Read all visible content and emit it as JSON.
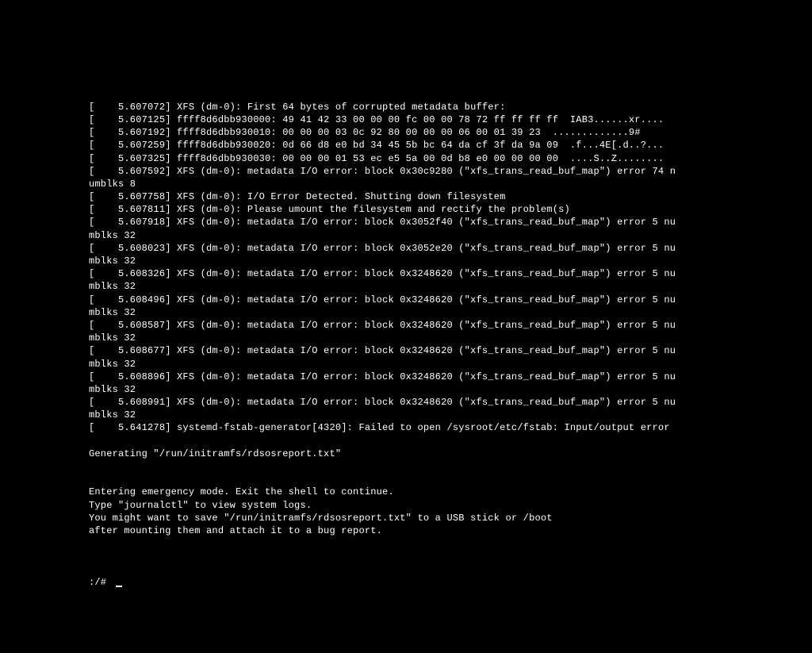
{
  "console": {
    "lines": [
      "[    5.607072] XFS (dm-0): First 64 bytes of corrupted metadata buffer:",
      "[    5.607125] ffff8d6dbb930000: 49 41 42 33 00 00 00 fc 00 00 78 72 ff ff ff ff  IAB3......xr....",
      "[    5.607192] ffff8d6dbb930010: 00 00 00 03 0c 92 80 00 00 00 06 00 01 39 23  .............9#",
      "[    5.607259] ffff8d6dbb930020: 0d 66 d8 e0 bd 34 45 5b bc 64 da cf 3f da 9a 09  .f...4E[.d..?...",
      "[    5.607325] ffff8d6dbb930030: 00 00 00 01 53 ec e5 5a 00 0d b8 e0 00 00 00 00  ....S..Z........",
      "[    5.607592] XFS (dm-0): metadata I/O error: block 0x30c9280 (\"xfs_trans_read_buf_map\") error 74 n",
      "umblks 8",
      "[    5.607758] XFS (dm-0): I/O Error Detected. Shutting down filesystem",
      "[    5.607811] XFS (dm-0): Please umount the filesystem and rectify the problem(s)",
      "[    5.607918] XFS (dm-0): metadata I/O error: block 0x3052f40 (\"xfs_trans_read_buf_map\") error 5 nu",
      "mblks 32",
      "[    5.608023] XFS (dm-0): metadata I/O error: block 0x3052e20 (\"xfs_trans_read_buf_map\") error 5 nu",
      "mblks 32",
      "[    5.608326] XFS (dm-0): metadata I/O error: block 0x3248620 (\"xfs_trans_read_buf_map\") error 5 nu",
      "mblks 32",
      "[    5.608496] XFS (dm-0): metadata I/O error: block 0x3248620 (\"xfs_trans_read_buf_map\") error 5 nu",
      "mblks 32",
      "[    5.608587] XFS (dm-0): metadata I/O error: block 0x3248620 (\"xfs_trans_read_buf_map\") error 5 nu",
      "mblks 32",
      "[    5.608677] XFS (dm-0): metadata I/O error: block 0x3248620 (\"xfs_trans_read_buf_map\") error 5 nu",
      "mblks 32",
      "[    5.608896] XFS (dm-0): metadata I/O error: block 0x3248620 (\"xfs_trans_read_buf_map\") error 5 nu",
      "mblks 32",
      "[    5.608991] XFS (dm-0): metadata I/O error: block 0x3248620 (\"xfs_trans_read_buf_map\") error 5 nu",
      "mblks 32",
      "[    5.641278] systemd-fstab-generator[4320]: Failed to open /sysroot/etc/fstab: Input/output error",
      "",
      "Generating \"/run/initramfs/rdsosreport.txt\"",
      "",
      "",
      "Entering emergency mode. Exit the shell to continue.",
      "Type \"journalctl\" to view system logs.",
      "You might want to save \"/run/initramfs/rdsosreport.txt\" to a USB stick or /boot",
      "after mounting them and attach it to a bug report.",
      "",
      ""
    ],
    "prompt": ":/# "
  }
}
